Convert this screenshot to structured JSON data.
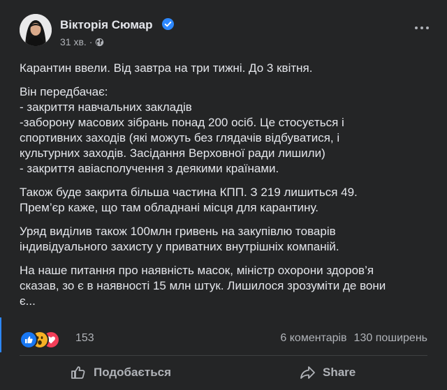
{
  "post": {
    "author": "Вікторія Сюмар",
    "time": "31 хв.",
    "separator": "·",
    "paragraphs": [
      [
        "Карантин ввели. Від завтра на три тижні. До 3 квітня."
      ],
      [
        "Він передбачає:",
        "- закриття навчальних закладів",
        "-заборону масових зібрань понад 200 осіб. Це стосується і",
        "спортивних заходів (які можуть без глядачів відбуватися, і",
        "культурних заходів. Засідання Верховної ради лишили)",
        "- закриття авіасполучення з деякими країнами."
      ],
      [
        "Також буде закрита більша частина КПП. З 219 лишиться 49.",
        "Прем’єр каже, що там обладнані місця для карантину."
      ],
      [
        "Уряд виділив також 100млн гривень на закупівлю товарів",
        "індивідуального захисту у приватних внутрішніх компаній."
      ],
      [
        "На наше питання про наявність масок, міністр охорони здоров’я",
        "сказав, зо є в наявності 15 млн штук. Лишилося зрозуміти де вони",
        "є..."
      ]
    ]
  },
  "reactions": {
    "icons": [
      "like-reaction",
      "wow-reaction",
      "love-reaction"
    ],
    "count": "153",
    "comments": "6 коментарів",
    "shares": "130 поширень"
  },
  "actions": {
    "like": "Подобається",
    "share": "Share"
  },
  "colors": {
    "background": "#242526",
    "text": "#e4e6eb",
    "secondary": "#b0b3b8",
    "verified": "#2d88ff",
    "like": "#1877f2",
    "love": "#f33e58",
    "wow": "#f7b125"
  }
}
